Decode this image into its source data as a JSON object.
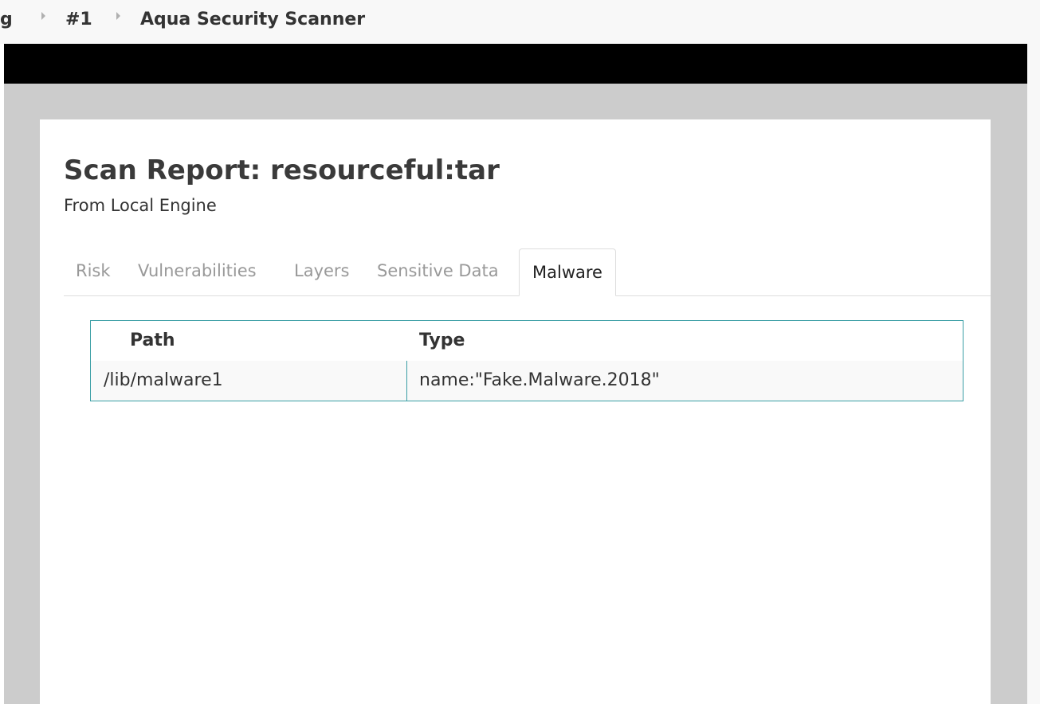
{
  "breadcrumbs": [
    {
      "label": "g"
    },
    {
      "label": "#1"
    },
    {
      "label": "Aqua Security Scanner"
    }
  ],
  "report": {
    "title": "Scan Report: resourceful:tar",
    "subtitle": "From Local Engine"
  },
  "tabs": [
    {
      "label": "Risk",
      "active": false
    },
    {
      "label": "Vulnerabilities",
      "active": false
    },
    {
      "label": "Layers",
      "active": false
    },
    {
      "label": "Sensitive Data",
      "active": false
    },
    {
      "label": "Malware",
      "active": true
    }
  ],
  "malware_table": {
    "columns": [
      "Path",
      "Type"
    ],
    "rows": [
      [
        "/lib/malware1",
        "name:\"Fake.Malware.2018\""
      ]
    ]
  },
  "colors": {
    "table_border": "#3a9ea5",
    "frame_background": "#cccccc",
    "header_bar": "#000000"
  }
}
